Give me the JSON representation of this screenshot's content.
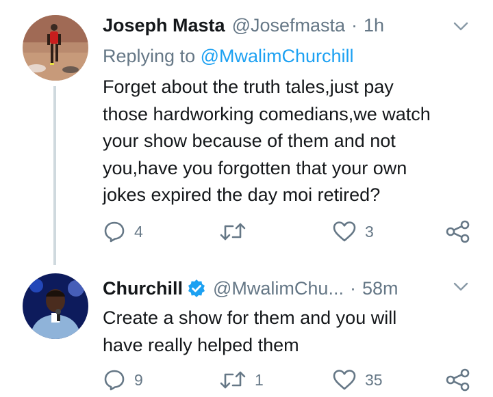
{
  "tweets": [
    {
      "name": "Joseph Masta",
      "handle": "@Josefmasta",
      "separator": "·",
      "time": "1h",
      "replying_label": "Replying to",
      "replying_to": "@MwalimChurchill",
      "text_lines": [
        "Forget about the truth tales,just pay",
        "those hardworking comedians,we watch",
        "your show because of them and not",
        "you,have you forgotten that your own",
        "jokes expired the day moi retired?"
      ],
      "replies": "4",
      "retweets": "",
      "likes": "3"
    },
    {
      "name": "Churchill",
      "verified": true,
      "handle": "@MwalimChu...",
      "separator": "·",
      "time": "58m",
      "text_lines": [
        "Create a show for them and you will",
        "have really helped them"
      ],
      "replies": "9",
      "retweets": "1",
      "likes": "35"
    }
  ],
  "colors": {
    "text": "#14171a",
    "secondary": "#657786",
    "accent": "#1da1f2",
    "thread_line": "#cfd9de"
  },
  "icons": [
    "reply-icon",
    "retweet-icon",
    "like-icon",
    "share-icon",
    "chevron-down-icon",
    "verified-badge-icon"
  ]
}
